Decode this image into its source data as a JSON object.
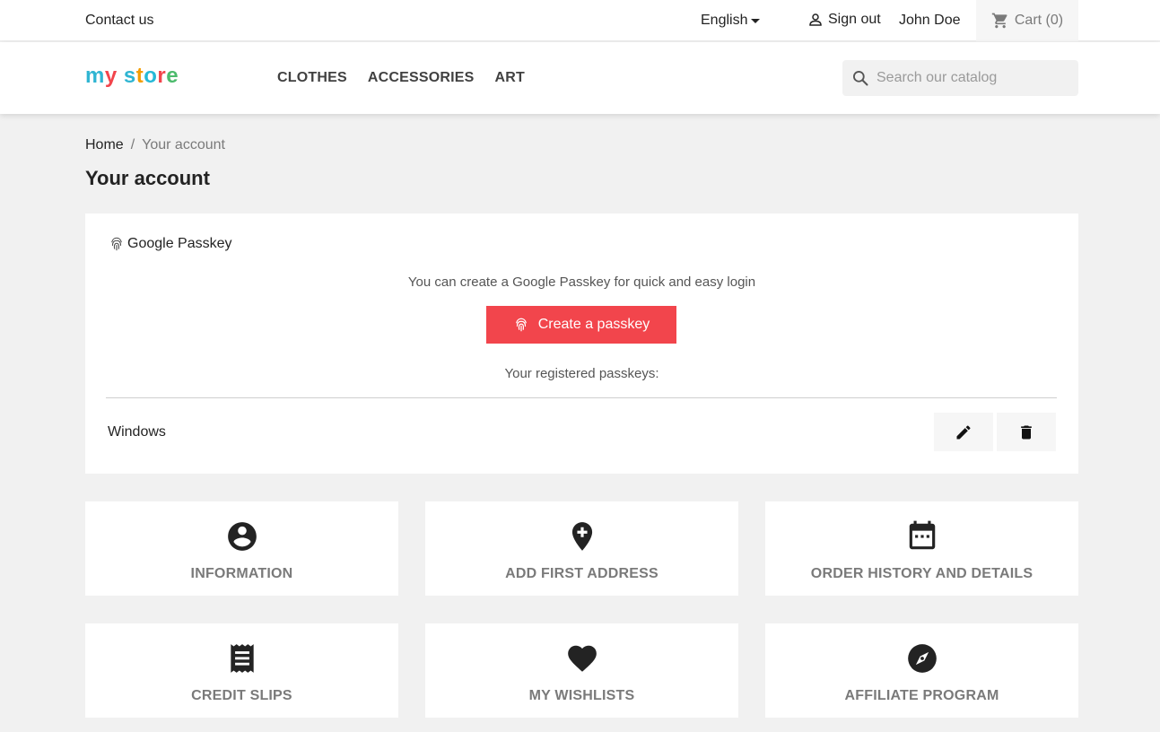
{
  "topbar": {
    "contact_label": "Contact us",
    "language_label": "English",
    "signout_label": "Sign out",
    "username": "John Doe",
    "cart_label": "Cart (0)"
  },
  "header": {
    "logo_part1": "my",
    "logo_part2": "store",
    "nav": [
      "CLOTHES",
      "ACCESSORIES",
      "ART"
    ],
    "search_placeholder": "Search our catalog"
  },
  "breadcrumb": {
    "home": "Home",
    "separator": "/",
    "current": "Your account"
  },
  "page_title": "Your account",
  "passkey": {
    "heading": "Google Passkey",
    "description": "You can create a Google Passkey for quick and easy login",
    "create_button_label": "Create a passkey",
    "registered_label": "Your registered passkeys:",
    "items": [
      {
        "name": "Windows"
      }
    ]
  },
  "tiles": [
    {
      "label": "INFORMATION",
      "icon": "account-circle-icon"
    },
    {
      "label": "ADD FIRST ADDRESS",
      "icon": "add-location-icon"
    },
    {
      "label": "ORDER HISTORY AND DETAILS",
      "icon": "calendar-icon"
    },
    {
      "label": "CREDIT SLIPS",
      "icon": "receipt-icon"
    },
    {
      "label": "MY WISHLISTS",
      "icon": "heart-icon"
    },
    {
      "label": "AFFILIATE PROGRAM",
      "icon": "compass-icon"
    }
  ],
  "colors": {
    "accent": "#f2454c",
    "background": "#f1f1f1",
    "text": "#232323",
    "muted": "#7a7a7a",
    "logo_m": "#2fb5d2",
    "logo_y": "#f2454c",
    "logo_s": "#2fb5d2",
    "logo_t": "#f39d00",
    "logo_o": "#25b9d7",
    "logo_r": "#f2454c",
    "logo_e": "#4cbb6c"
  }
}
